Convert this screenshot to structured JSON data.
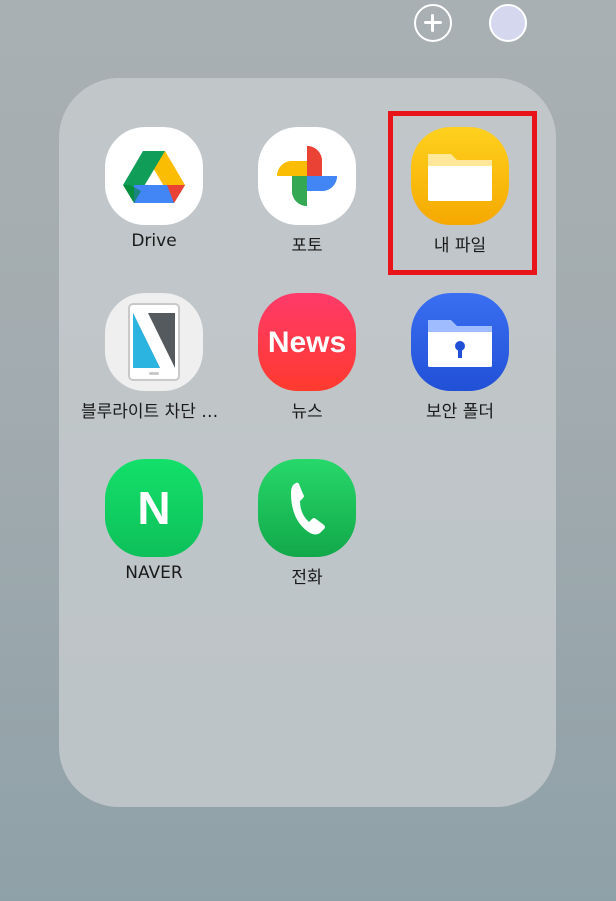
{
  "top_bar": {
    "add_icon": "plus-circle-icon",
    "color_swatch": "#d4d7ee"
  },
  "folder": {
    "apps": [
      {
        "label": "Drive",
        "icon": "google-drive-icon"
      },
      {
        "label": "포토",
        "icon": "google-photos-icon"
      },
      {
        "label": "내 파일",
        "icon": "my-files-folder-icon",
        "highlighted": true
      },
      {
        "label": "블루라이트 차단 스...",
        "icon": "blue-light-filter-icon"
      },
      {
        "label": "뉴스",
        "icon": "news-icon",
        "icon_text": "News"
      },
      {
        "label": "보안 폴더",
        "icon": "secure-folder-icon"
      },
      {
        "label": "NAVER",
        "icon": "naver-icon",
        "icon_text": "N"
      },
      {
        "label": "전화",
        "icon": "phone-icon"
      }
    ]
  },
  "highlight_color": "#e8141a"
}
